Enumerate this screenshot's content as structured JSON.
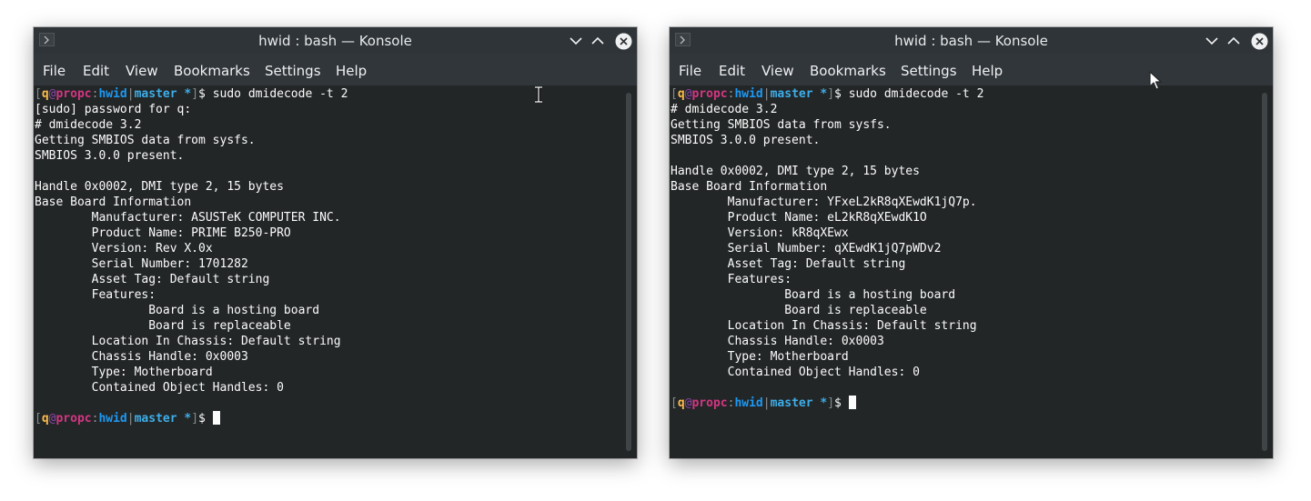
{
  "colors": {
    "terminal_bg": "#232627",
    "titlebar_bg": "#2f3438",
    "menubar_bg": "#31363b",
    "text": "#fcfcfc",
    "prompt_user": "#fdbc4b",
    "prompt_host": "#d33682",
    "prompt_dir": "#1d99f3",
    "prompt_branch": "#3daee9"
  },
  "prompt": {
    "open": "[",
    "user": "q",
    "at": "@",
    "host": "propc",
    "colon": ":",
    "dir": "hwid",
    "pipe": "|",
    "branch": "master",
    "star": " *",
    "close": "]",
    "symbol": "$"
  },
  "left_window": {
    "title": "hwid : bash — Konsole",
    "menu": [
      "File",
      "Edit",
      "View",
      "Bookmarks",
      "Settings",
      "Help"
    ],
    "command": " sudo dmidecode -t 2",
    "output": "[sudo] password for q:\n# dmidecode 3.2\nGetting SMBIOS data from sysfs.\nSMBIOS 3.0.0 present.\n\nHandle 0x0002, DMI type 2, 15 bytes\nBase Board Information\n        Manufacturer: ASUSTeK COMPUTER INC.\n        Product Name: PRIME B250-PRO\n        Version: Rev X.0x\n        Serial Number: 1701282\n        Asset Tag: Default string\n        Features:\n                Board is a hosting board\n                Board is replaceable\n        Location In Chassis: Default string\n        Chassis Handle: 0x0003\n        Type: Motherboard\n        Contained Object Handles: 0\n"
  },
  "right_window": {
    "title": "hwid : bash — Konsole",
    "menu": [
      "File",
      "Edit",
      "View",
      "Bookmarks",
      "Settings",
      "Help"
    ],
    "command": " sudo dmidecode -t 2",
    "output": "# dmidecode 3.2\nGetting SMBIOS data from sysfs.\nSMBIOS 3.0.0 present.\n\nHandle 0x0002, DMI type 2, 15 bytes\nBase Board Information\n        Manufacturer: YFxeL2kR8qXEwdK1jQ7p.\n        Product Name: eL2kR8qXEwdK1O\n        Version: kR8qXEwx\n        Serial Number: qXEwdK1jQ7pWDv2\n        Asset Tag: Default string\n        Features:\n                Board is a hosting board\n                Board is replaceable\n        Location In Chassis: Default string\n        Chassis Handle: 0x0003\n        Type: Motherboard\n        Contained Object Handles: 0\n"
  },
  "icons": {
    "system_menu": "terminal-icon",
    "minimize": "chevron-down-icon",
    "maximize": "chevron-up-icon",
    "close": "close-icon",
    "text_cursor": "i-beam-cursor-icon",
    "mouse_pointer": "arrow-pointer-icon"
  }
}
